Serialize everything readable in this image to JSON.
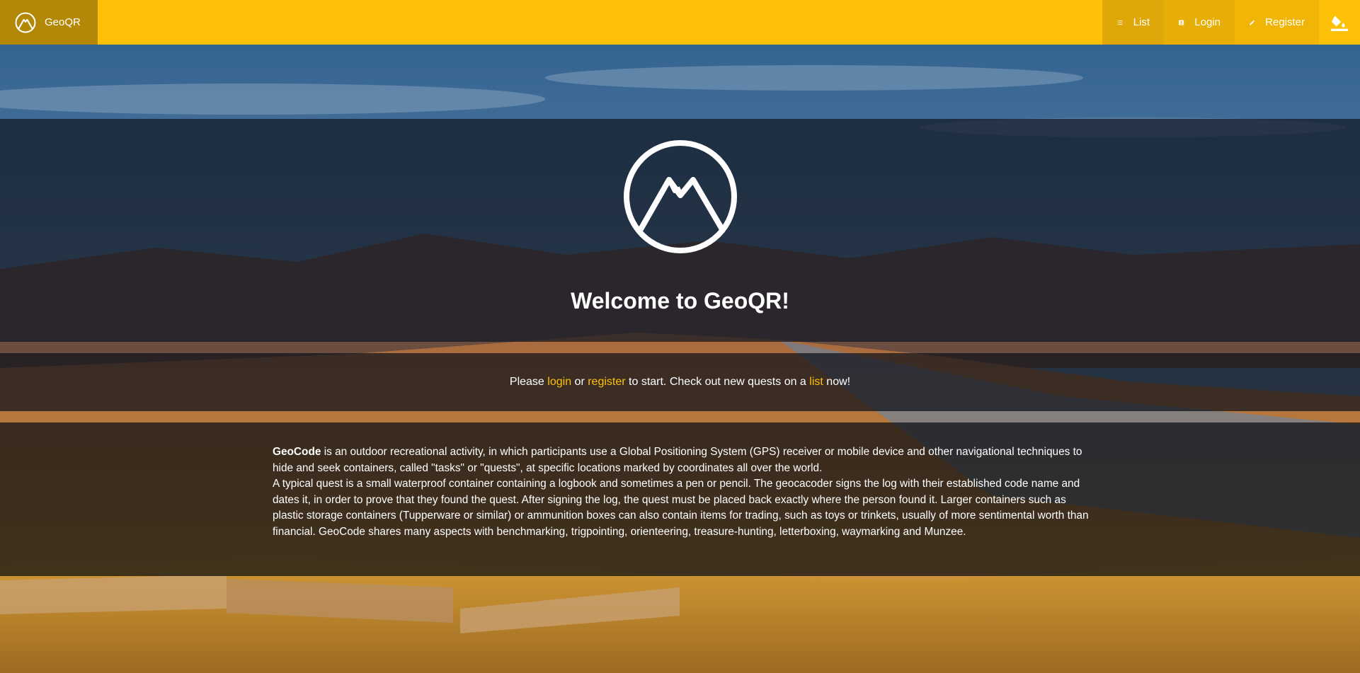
{
  "brand": {
    "name": "GeoQR",
    "icon": "mountain-logo-icon"
  },
  "nav": {
    "list_label": "List",
    "login_label": "Login",
    "register_label": "Register",
    "theme_icon": "paint-bucket-icon"
  },
  "hero": {
    "title": "Welcome to GeoQR!",
    "logo_icon": "mountain-logo-icon"
  },
  "cta": {
    "prefix": "Please ",
    "login_link": "login",
    "or": " or ",
    "register_link": "register",
    "middle": " to start. Check out new quests on a ",
    "list_link": "list",
    "suffix": " now!"
  },
  "info": {
    "term": "GeoCode",
    "line1": " is an outdoor recreational activity, in which participants use a Global Positioning System (GPS) receiver or mobile device and other navigational techniques to hide and seek containers, called \"tasks\" or \"quests\", at specific locations marked by coordinates all over the world.",
    "line2": "A typical quest is a small waterproof container containing a logbook and sometimes a pen or pencil. The geocacoder signs the log with their established code name and dates it, in order to prove that they found the quest. After signing the log, the quest must be placed back exactly where the person found it. Larger containers such as plastic storage containers (Tupperware or similar) or ammunition boxes can also contain items for trading, such as toys or trinkets, usually of more sentimental worth than financial. GeoCode shares many aspects with benchmarking, trigpointing, orienteering, treasure-hunting, letterboxing, waymarking and Munzee."
  },
  "colors": {
    "accent": "#ffc107",
    "brand_bg": "#b38806",
    "link": "#ffc107"
  }
}
